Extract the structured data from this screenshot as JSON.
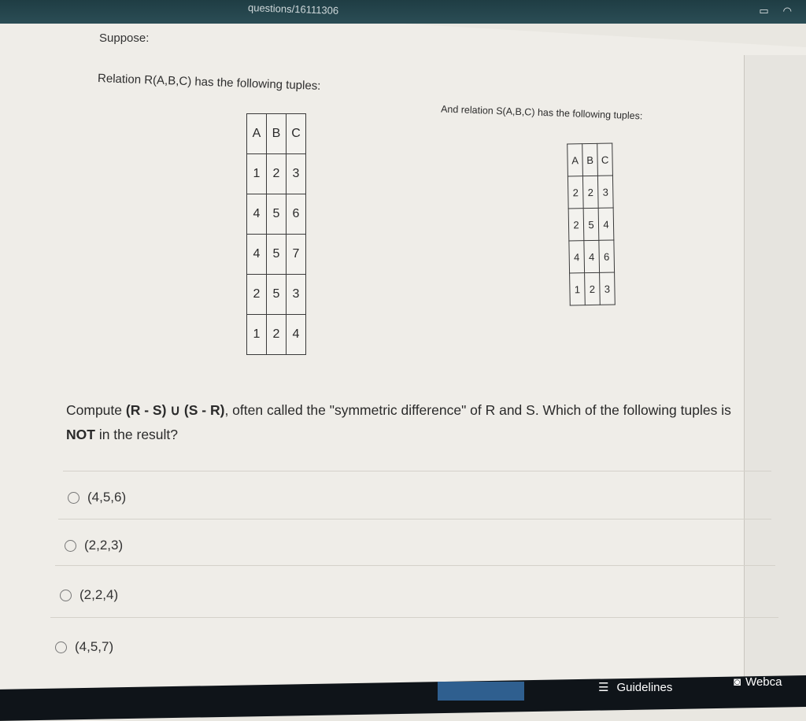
{
  "browser": {
    "url_fragment": "questions/16111306"
  },
  "prompt": {
    "suppose": "Suppose:",
    "relation_r": "Relation R(A,B,C) has the following tuples:",
    "relation_s": "And relation S(A,B,C) has the following tuples:"
  },
  "table_r": {
    "headers": [
      "A",
      "B",
      "C"
    ],
    "rows": [
      [
        "1",
        "2",
        "3"
      ],
      [
        "4",
        "5",
        "6"
      ],
      [
        "4",
        "5",
        "7"
      ],
      [
        "2",
        "5",
        "3"
      ],
      [
        "1",
        "2",
        "4"
      ]
    ]
  },
  "table_s": {
    "headers": [
      "A",
      "B",
      "C"
    ],
    "rows": [
      [
        "2",
        "2",
        "3"
      ],
      [
        "2",
        "5",
        "4"
      ],
      [
        "4",
        "4",
        "6"
      ],
      [
        "1",
        "2",
        "3"
      ]
    ]
  },
  "question": {
    "p1": "Compute ",
    "b1": "(R - S) ∪ (S - R)",
    "p2": ", often called the \"symmetric difference\" of R and S. Which of the following tuples is ",
    "b2": "NOT",
    "p3": " in the result?"
  },
  "options": [
    "(4,5,6)",
    "(2,2,3)",
    "(2,2,4)",
    "(4,5,7)"
  ],
  "footer": {
    "guidelines": "Guidelines",
    "webcam": "Webca"
  }
}
